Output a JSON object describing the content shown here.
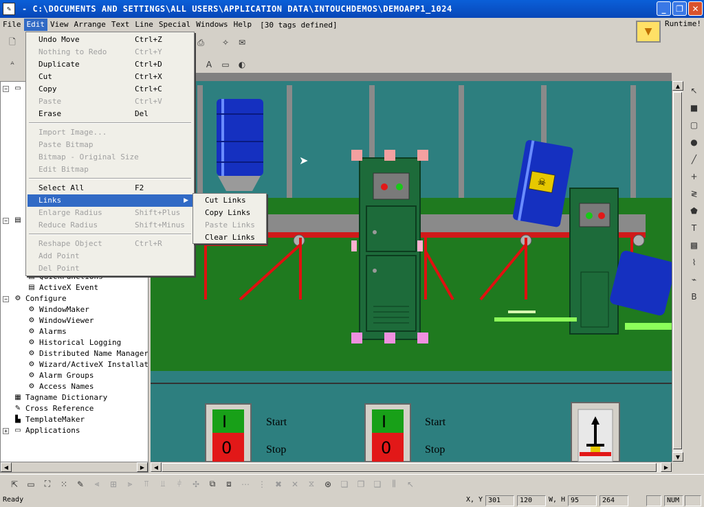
{
  "window": {
    "title": "- C:\\DOCUMENTS AND SETTINGS\\ALL USERS\\APPLICATION DATA\\INTOUCHDEMOS\\DEMOAPP1_1024",
    "buttons": [
      "minimize",
      "restore",
      "close"
    ]
  },
  "menubar": {
    "items": [
      "File",
      "Edit",
      "View",
      "Arrange",
      "Text",
      "Line",
      "Special",
      "Windows",
      "Help"
    ],
    "tag_count": "[30 tags defined]",
    "runtime": "Runtime!"
  },
  "edit_menu": {
    "items": [
      {
        "label": "Undo Move",
        "shortcut": "Ctrl+Z",
        "enabled": true
      },
      {
        "label": "Nothing to Redo",
        "shortcut": "Ctrl+Y",
        "enabled": false
      },
      {
        "label": "Duplicate",
        "shortcut": "Ctrl+D",
        "enabled": true
      },
      {
        "label": "Cut",
        "shortcut": "Ctrl+X",
        "enabled": true
      },
      {
        "label": "Copy",
        "shortcut": "Ctrl+C",
        "enabled": true
      },
      {
        "label": "Paste",
        "shortcut": "Ctrl+V",
        "enabled": false
      },
      {
        "label": "Erase",
        "shortcut": "Del",
        "enabled": true
      },
      {
        "label": "Import Image...",
        "shortcut": "",
        "enabled": false
      },
      {
        "label": "Paste Bitmap",
        "shortcut": "",
        "enabled": false
      },
      {
        "label": "Bitmap - Original Size",
        "shortcut": "",
        "enabled": false
      },
      {
        "label": "Edit Bitmap",
        "shortcut": "",
        "enabled": false
      },
      {
        "label": "Select All",
        "shortcut": "F2",
        "enabled": true
      },
      {
        "label": "Links",
        "shortcut": "",
        "enabled": true,
        "highlighted": true
      },
      {
        "label": "Enlarge Radius",
        "shortcut": "Shift+Plus",
        "enabled": false
      },
      {
        "label": "Reduce Radius",
        "shortcut": "Shift+Minus",
        "enabled": false
      },
      {
        "label": "Reshape Object",
        "shortcut": "Ctrl+R",
        "enabled": false
      },
      {
        "label": "Add Point",
        "shortcut": "",
        "enabled": false
      },
      {
        "label": "Del Point",
        "shortcut": "",
        "enabled": false
      }
    ]
  },
  "links_submenu": {
    "items": [
      {
        "label": "Cut Links",
        "enabled": true
      },
      {
        "label": "Copy Links",
        "enabled": true
      },
      {
        "label": "Paste Links",
        "enabled": false
      },
      {
        "label": "Clear Links",
        "enabled": true
      }
    ]
  },
  "tree": {
    "items": [
      {
        "label": "QuickFunctions"
      },
      {
        "label": "ActiveX Event"
      },
      {
        "label": "Configure"
      },
      {
        "label": "WindowMaker"
      },
      {
        "label": "WindowViewer"
      },
      {
        "label": "Alarms"
      },
      {
        "label": "Historical Logging"
      },
      {
        "label": "Distributed Name Manager"
      },
      {
        "label": "Wizard/ActiveX Installatio"
      },
      {
        "label": "Alarm Groups"
      },
      {
        "label": "Access Names"
      },
      {
        "label": "Tagname Dictionary"
      },
      {
        "label": "Cross Reference"
      },
      {
        "label": "TemplateMaker"
      },
      {
        "label": "Applications"
      }
    ]
  },
  "canvas": {
    "start_label_1": "Start",
    "stop_label_1": "Stop",
    "start_label_2": "Start",
    "stop_label_2": "Stop",
    "switch_on": "I",
    "switch_off": "0"
  },
  "status": {
    "ready": "Ready",
    "xy_label": "X, Y",
    "x": "301",
    "y": "120",
    "wh_label": "W, H",
    "w": "95",
    "h": "264",
    "num": "NUM"
  },
  "colors": {
    "title_blue": "#0a5fd8",
    "menu_highlight": "#316ac5",
    "floor_green": "#1f7a1f",
    "wall_teal": "#2d7f7f",
    "machine_green": "#1d6b3a"
  }
}
